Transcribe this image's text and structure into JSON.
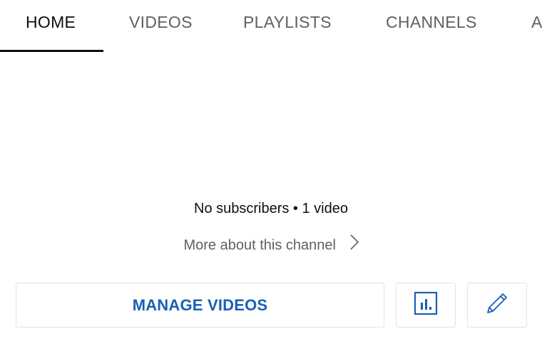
{
  "tabs": [
    {
      "label": "HOME",
      "active": true
    },
    {
      "label": "VIDEOS",
      "active": false
    },
    {
      "label": "PLAYLISTS",
      "active": false
    },
    {
      "label": "CHANNELS",
      "active": false
    },
    {
      "label": "A",
      "active": false
    }
  ],
  "channel": {
    "stats": "No subscribers • 1 video",
    "more_link": "More about this channel"
  },
  "actions": {
    "manage_videos_label": "MANAGE VIDEOS",
    "analytics_icon": "analytics-icon",
    "edit_icon": "pencil-icon"
  },
  "colors": {
    "accent": "#1a5fb4",
    "tab_active": "#0f0f0f",
    "tab_inactive": "#606060"
  }
}
